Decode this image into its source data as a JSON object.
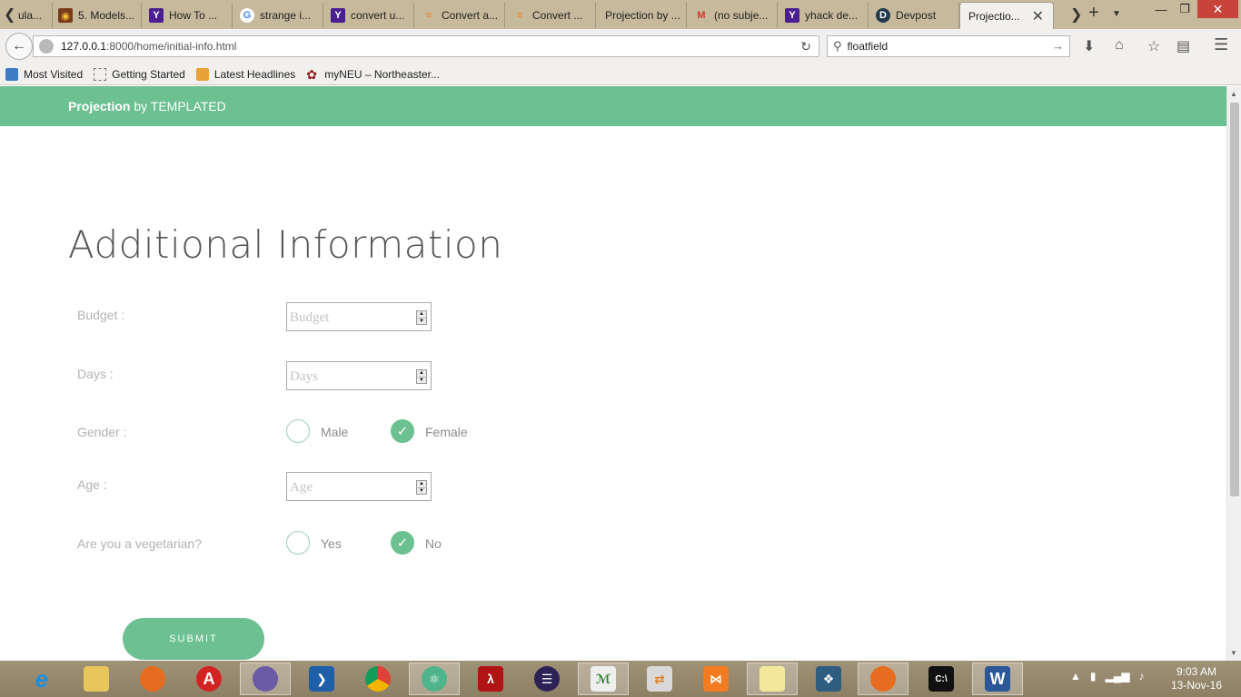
{
  "browser": {
    "tabs": [
      {
        "label": "ula...",
        "icon": "mandala-favicon-icon"
      },
      {
        "label": "5. Models...",
        "icon": "djangogirls-favicon-icon"
      },
      {
        "label": "How To ...",
        "icon": "yahoo-answers-favicon-icon"
      },
      {
        "label": "strange i...",
        "icon": "google-favicon-icon"
      },
      {
        "label": "convert u...",
        "icon": "yahoo-answers-favicon-icon"
      },
      {
        "label": "Convert a...",
        "icon": "stackoverflow-favicon-icon"
      },
      {
        "label": "Convert ...",
        "icon": "stackoverflow-favicon-icon"
      },
      {
        "label": "Projection by ...",
        "icon": "blank-favicon-icon"
      },
      {
        "label": "(no subje...",
        "icon": "gmail-favicon-icon"
      },
      {
        "label": "yhack de...",
        "icon": "yahoo-answers-favicon-icon"
      },
      {
        "label": "Devpost",
        "icon": "devpost-favicon-icon"
      },
      {
        "label": "Projectio...",
        "icon": "none",
        "active": true
      }
    ],
    "url_host": "127.0.0.1",
    "url_rest": ":8000/home/initial-info.html",
    "search_value": "floatfield",
    "bookmarks": [
      {
        "label": "Most Visited",
        "icon": "most-visited-icon"
      },
      {
        "label": "Getting Started",
        "icon": "page-icon"
      },
      {
        "label": "Latest Headlines",
        "icon": "rss-icon"
      },
      {
        "label": "myNEU – Northeaster...",
        "icon": "paw-icon"
      }
    ]
  },
  "site": {
    "brand_strong": "Projection",
    "brand_rest": " by TEMPLATED",
    "accent": "#6cc091"
  },
  "form": {
    "title": "Additional Information",
    "budget_label": "Budget :",
    "budget_placeholder": "Budget",
    "days_label": "Days :",
    "days_placeholder": "Days",
    "gender_label": "Gender :",
    "gender_options": [
      {
        "label": "Male",
        "checked": false
      },
      {
        "label": "Female",
        "checked": true
      }
    ],
    "age_label": "Age :",
    "age_placeholder": "Age",
    "veg_label": "Are you a vegetarian?",
    "veg_options": [
      {
        "label": "Yes",
        "checked": false
      },
      {
        "label": "No",
        "checked": true
      }
    ],
    "submit_label": "SUBMIT"
  },
  "taskbar": {
    "time": "9:03 AM",
    "date": "13-Nov-16",
    "apps": [
      "internet-explorer-icon",
      "file-explorer-icon",
      "firefox-icon",
      "adobe-icon",
      "github-desktop-icon",
      "powershell-icon",
      "chrome-icon",
      "atom-icon",
      "acrobat-reader-icon",
      "eclipse-icon",
      "rstudio-icon",
      "file-transfer-icon",
      "xampp-icon",
      "sticky-notes-icon",
      "mysql-workbench-icon",
      "firefox-icon",
      "cmd-icon",
      "word-icon"
    ]
  }
}
